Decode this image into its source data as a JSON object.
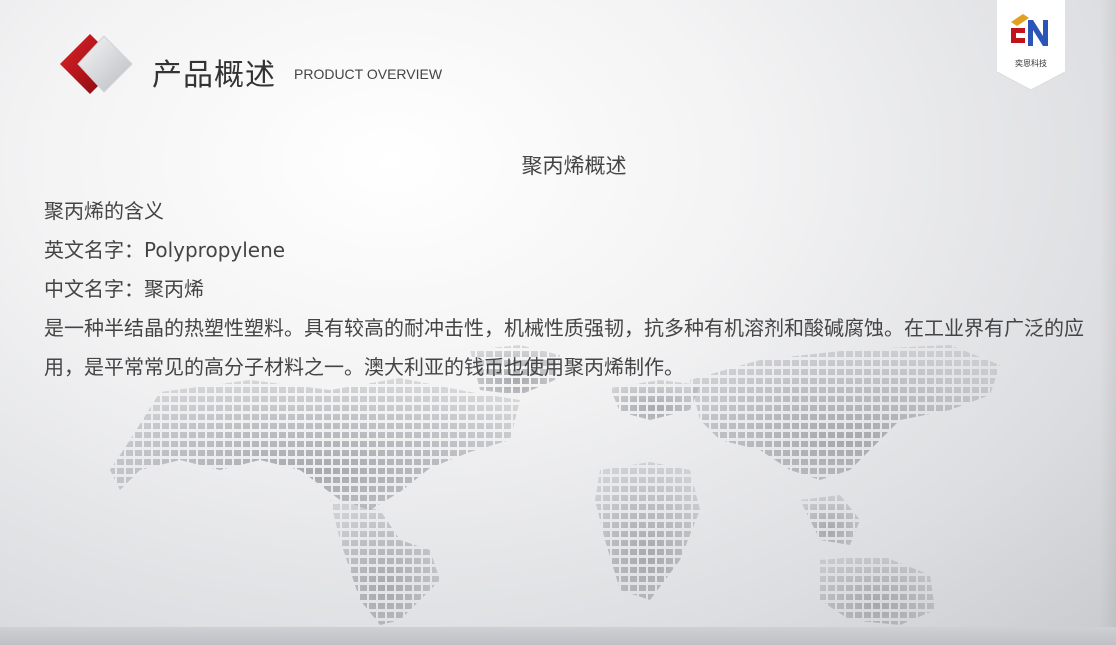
{
  "header": {
    "title": "产品概述",
    "subtitle": "PRODUCT OVERVIEW"
  },
  "logo": {
    "caption": "奕恩科技",
    "colors": {
      "accent_red": "#c0141a",
      "accent_blue": "#2b54b8",
      "accent_gold": "#e0a020"
    }
  },
  "content": {
    "heading": "聚丙烯概述",
    "lines": [
      "聚丙烯的含义",
      "英文名字：Polypropylene",
      "中文名字：聚丙烯"
    ],
    "paragraph": "是一种半结晶的热塑性塑料。具有较高的耐冲击性，机械性质强韧，抗多种有机溶剂和酸碱腐蚀。在工业界有广泛的应用，是平常常见的高分子材料之一。澳大利亚的钱币也使用聚丙烯制作。"
  },
  "icons": {
    "header": "chevron-left-diamond-icon",
    "background": "world-map-dots"
  }
}
